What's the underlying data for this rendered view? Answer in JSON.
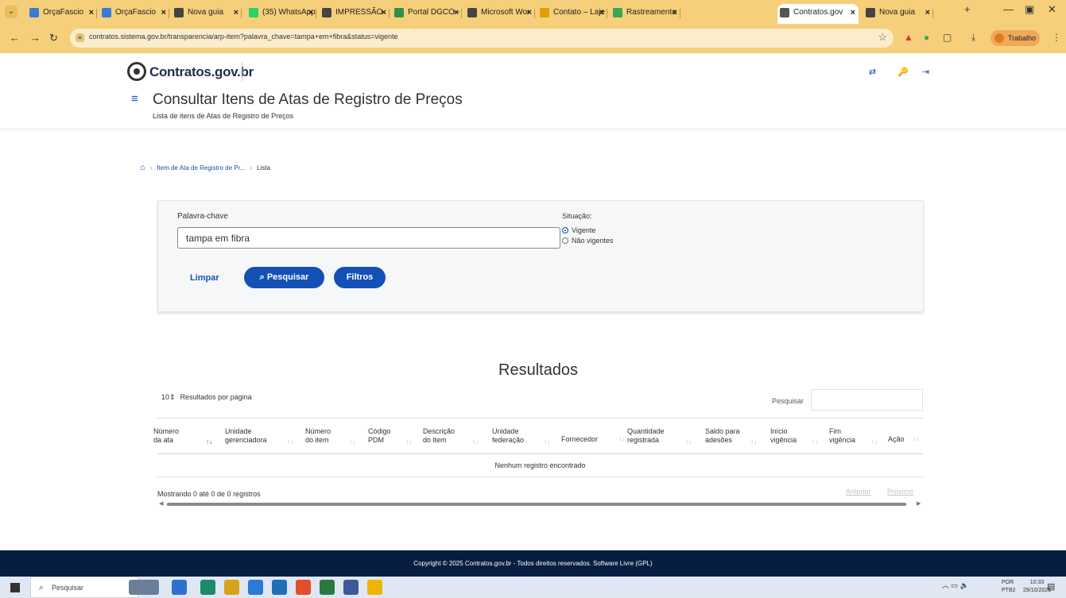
{
  "browser": {
    "tabs": [
      {
        "title": "OrçaFascio",
        "color": "#3a7bd5"
      },
      {
        "title": "OrçaFascio",
        "color": "#3a7bd5"
      },
      {
        "title": "Nova guia",
        "color": "#444444"
      },
      {
        "title": "(35) WhatsApp",
        "color": "#25d366"
      },
      {
        "title": "IMPRESSÃO",
        "color": "#444444"
      },
      {
        "title": "Portal DGCO - ",
        "color": "#2b9348"
      },
      {
        "title": "Microsoft Wor",
        "color": "#444444"
      },
      {
        "title": "Contato – Laje",
        "color": "#e0a000"
      },
      {
        "title": "Rastreamento",
        "color": "#3aa655"
      },
      {
        "title": "Contratos.gov",
        "color": "#555555"
      },
      {
        "title": "Nova guia",
        "color": "#444444"
      }
    ],
    "new_tab_glyph": "+",
    "url": "contratos.sistema.gov.br/transparencia/arp-item?palavra_chave=tampa+em+fibra&status=vigente",
    "profile_label": "Trabalho"
  },
  "header": {
    "logo_text": "Contratos.gov.br",
    "title": "Consultar Itens de Atas de Registro de Preços",
    "subtitle": "Lista de itens de Atas de Registro de Preços"
  },
  "breadcrumb": {
    "items": [
      "Item de Ata de Registro de Pr...",
      "Lista"
    ]
  },
  "filter": {
    "keyword_label": "Palavra-chave",
    "keyword_value": "tampa em fibra",
    "status_label": "Situação:",
    "status_options": [
      "Vigente",
      "Não vigentes"
    ],
    "selected_status": "Vigente",
    "clear_label": "Limpar",
    "search_label": "Pesquisar",
    "filters_label": "Filtros"
  },
  "results": {
    "title": "Resultados",
    "page_size": "10",
    "page_size_label": "Resultados por página",
    "search_label": "Pesquisar",
    "columns": [
      [
        "Número",
        "da ata"
      ],
      [
        "Unidade",
        "gerenciadora"
      ],
      [
        "Número",
        "do item"
      ],
      [
        "Código",
        "PDM"
      ],
      [
        "Descrição",
        "do item"
      ],
      [
        "Unidade",
        "federação"
      ],
      [
        "Fornecedor",
        ""
      ],
      [
        "Quantidade",
        "registrada"
      ],
      [
        "Saldo para",
        "adesões"
      ],
      [
        "Início",
        "vigência"
      ],
      [
        "Fim",
        "vigência"
      ],
      [
        "Ação",
        ""
      ]
    ],
    "empty_message": "Nenhum registro encontrado",
    "showing": "Mostrando 0 até 0 de 0 registros",
    "prev_label": "Anterior",
    "next_label": "Próximo"
  },
  "footer": {
    "text": "Copyright © 2025 Contratos.gov.br - Todos direitos reservados. Software Livre (GPL)"
  },
  "taskbar": {
    "search_placeholder": "Pesquisar",
    "lang_line1": "POR",
    "lang_line2": "PTB2",
    "time": "10:33",
    "date": "29/10/2025",
    "app_colors": [
      "#6b7f99",
      "#2f6fd0",
      "#1a8a6a",
      "#d9a21b",
      "#2a7bd4",
      "#1d6fb8",
      "#e24e2a",
      "#2b7a3d",
      "#3c5a99",
      "#f0b400"
    ]
  }
}
